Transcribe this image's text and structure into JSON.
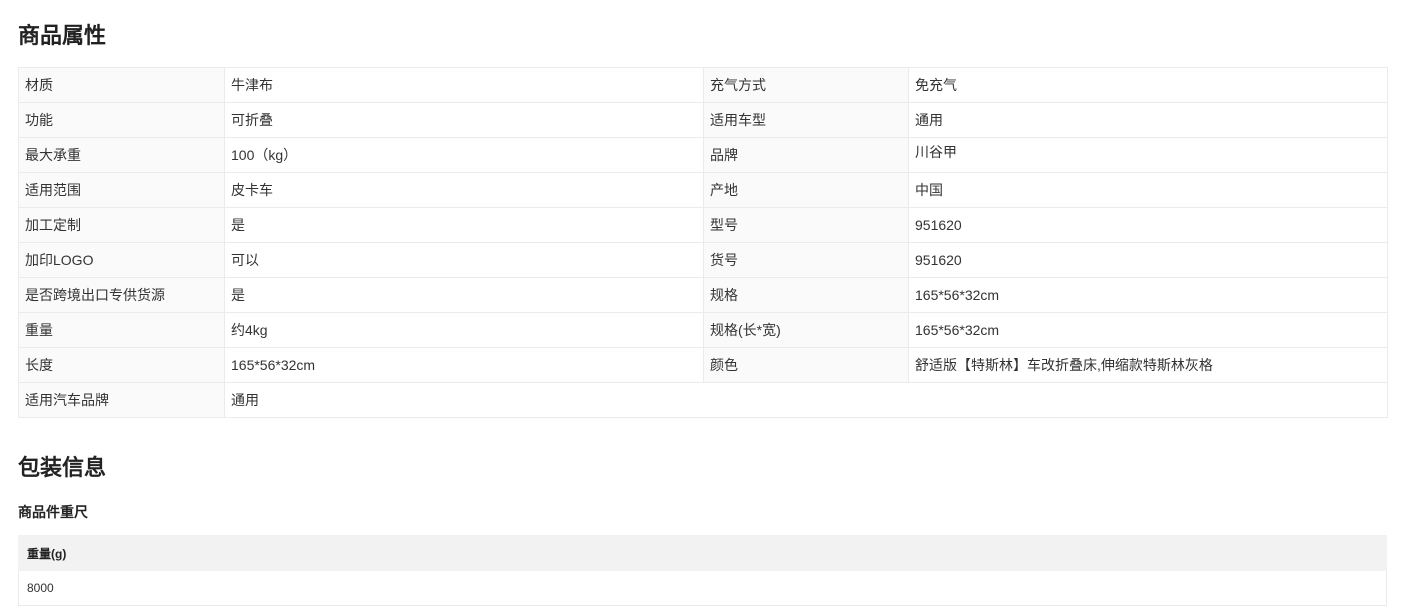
{
  "theme": {
    "text": "#333333",
    "title": "#222222",
    "border": "#ebebeb",
    "label_background": "#fafafa",
    "header_background": "#f2f2f2"
  },
  "attributes": {
    "title": "商品属性",
    "rows": [
      {
        "label_left": "材质",
        "value_left": "牛津布",
        "label_right": "充气方式",
        "value_right": "免充气"
      },
      {
        "label_left": "功能",
        "value_left": "可折叠",
        "label_right": "适用车型",
        "value_right": "通用"
      },
      {
        "label_left": "最大承重",
        "value_left": "100（kg）",
        "label_right": "品牌",
        "value_right": "川谷甲"
      },
      {
        "label_left": "适用范围",
        "value_left": "皮卡车",
        "label_right": "产地",
        "value_right": "中国"
      },
      {
        "label_left": "加工定制",
        "value_left": "是",
        "label_right": "型号",
        "value_right": "951620"
      },
      {
        "label_left": "加印LOGO",
        "value_left": "可以",
        "label_right": "货号",
        "value_right": "951620"
      },
      {
        "label_left": "是否跨境出口专供货源",
        "value_left": "是",
        "label_right": "规格",
        "value_right": "165*56*32cm"
      },
      {
        "label_left": "重量",
        "value_left": "约4kg",
        "label_right": "规格(长*宽)",
        "value_right": "165*56*32cm"
      },
      {
        "label_left": "长度",
        "value_left": "165*56*32cm",
        "label_right": "颜色",
        "value_right": "舒适版【特斯林】车改折叠床,伸缩款特斯林灰格"
      },
      {
        "label_left": "适用汽车品牌",
        "value_left": "通用"
      }
    ]
  },
  "packaging": {
    "title": "包装信息",
    "subtitle": "商品件重尺",
    "columns": [
      "重量(g)"
    ],
    "rows": [
      [
        "8000"
      ]
    ]
  }
}
